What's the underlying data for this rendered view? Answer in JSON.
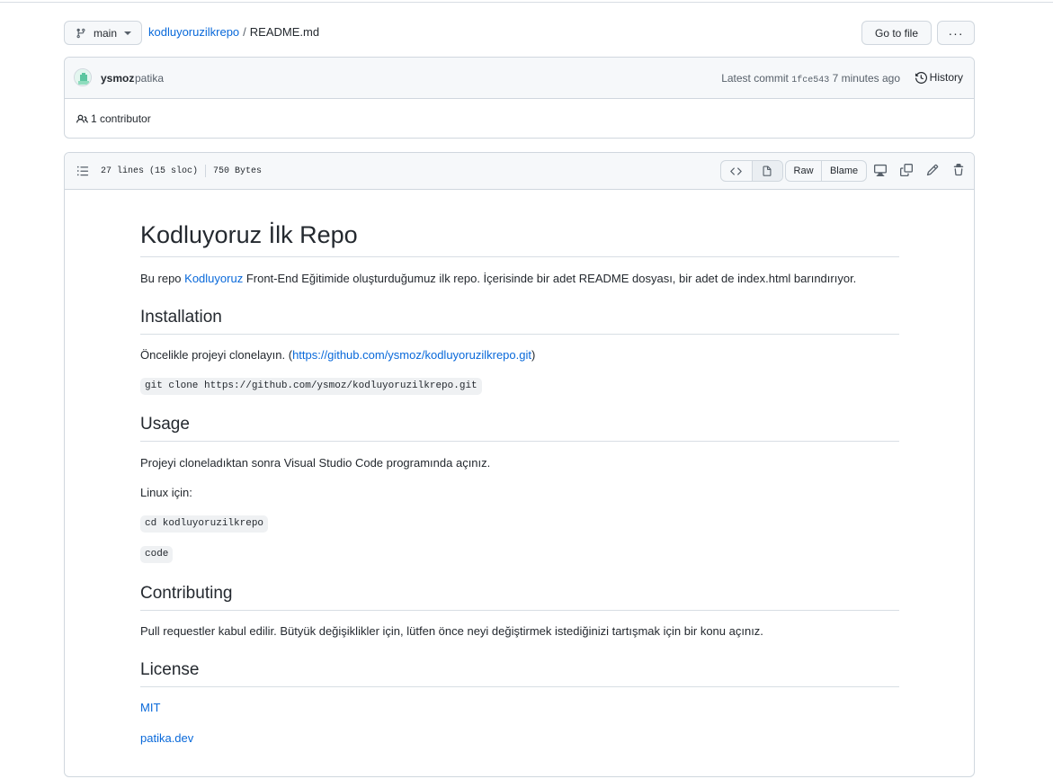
{
  "header": {
    "branch": "main",
    "repo": "kodluyoruzilkrepo",
    "separator": "/",
    "file": "README.md",
    "goto_file": "Go to file",
    "more": "···"
  },
  "commit": {
    "author": "ysmoz",
    "message": "patika",
    "latest_label": "Latest commit",
    "sha": "1fce543",
    "time": "7 minutes ago",
    "history": "History",
    "contributors": "1 contributor"
  },
  "file": {
    "lines": "27 lines (15 sloc)",
    "size": "750 Bytes",
    "raw": "Raw",
    "blame": "Blame"
  },
  "readme": {
    "title": "Kodluyoruz İlk Repo",
    "intro_prefix": "Bu repo ",
    "intro_link": "Kodluyoruz",
    "intro_suffix": " Front-End Eğitimide oluşturduğumuz ilk repo. İçerisinde bir adet README dosyası, bir adet de index.html barındırıyor.",
    "installation_heading": "Installation",
    "install_prefix": "Öncelikle projeyi clonelayın. (",
    "install_link": "https://github.com/ysmoz/kodluyoruzilkrepo.git",
    "install_suffix": ")",
    "clone_cmd": "git clone https://github.com/ysmoz/kodluyoruzilkrepo.git",
    "usage_heading": "Usage",
    "usage_text": "Projeyi cloneladıktan sonra Visual Studio Code programında açınız.",
    "linux_text": "Linux için:",
    "cd_cmd": "cd kodluyoruzilkrepo",
    "code_cmd": "code",
    "contributing_heading": "Contributing",
    "contributing_text": "Pull requestler kabul edilir. Bütyük değişiklikler için, lütfen önce neyi değiştirmek istediğinizi tartışmak için bir konu açınız.",
    "license_heading": "License",
    "license_link": "MIT",
    "patika_link": "patika.dev"
  },
  "colors": {
    "link": "#0969da",
    "border": "#d0d7de",
    "header_bg": "#f6f8fa"
  }
}
